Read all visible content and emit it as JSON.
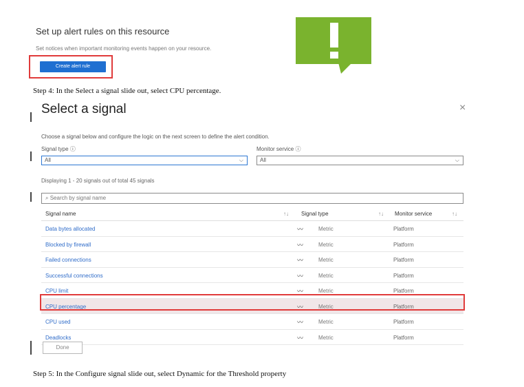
{
  "header": {
    "title": "Set up alert rules on this resource",
    "description": "Set notices when important monitoring events happen on your resource.",
    "create_button": "Create alert rule"
  },
  "alert_icon": {
    "icon": "exclamation-icon",
    "color": "#7ab32e"
  },
  "steps": {
    "step4": "Step 4: In the Select a signal slide out, select CPU percentage.",
    "step5": "Step 5: In the Configure signal slide out, select Dynamic for the Threshold property"
  },
  "panel": {
    "title": "Select a signal",
    "close": "×",
    "description": "Choose a signal below and configure the logic on the next screen to define the alert condition.",
    "signal_type_label": "Signal type",
    "signal_type_value": "All",
    "monitor_service_label": "Monitor service",
    "monitor_service_value": "All",
    "info_glyph": "ⓘ",
    "chevron": "⌵",
    "count_text": "Displaying 1 - 20 signals out of total 45 signals",
    "search_placeholder": "Search by signal name",
    "search_glyph": "⌕",
    "columns": [
      "Signal name",
      "Signal type",
      "Monitor service"
    ],
    "sort_glyph": "↑↓",
    "rows": [
      {
        "name": "Data bytes allocated",
        "type": "Metric",
        "service": "Platform"
      },
      {
        "name": "Blocked by firewall",
        "type": "Metric",
        "service": "Platform"
      },
      {
        "name": "Failed connections",
        "type": "Metric",
        "service": "Platform"
      },
      {
        "name": "Successful connections",
        "type": "Metric",
        "service": "Platform"
      },
      {
        "name": "CPU limit",
        "type": "Metric",
        "service": "Platform"
      },
      {
        "name": "CPU percentage",
        "type": "Metric",
        "service": "Platform"
      },
      {
        "name": "CPU used",
        "type": "Metric",
        "service": "Platform"
      },
      {
        "name": "Deadlocks",
        "type": "Metric",
        "service": "Platform"
      }
    ],
    "trend_glyph": "〰",
    "done_button": "Done"
  },
  "colors": {
    "accent": "#1f6fd1",
    "highlight": "#e03a3a",
    "link": "#2f6cc9"
  }
}
